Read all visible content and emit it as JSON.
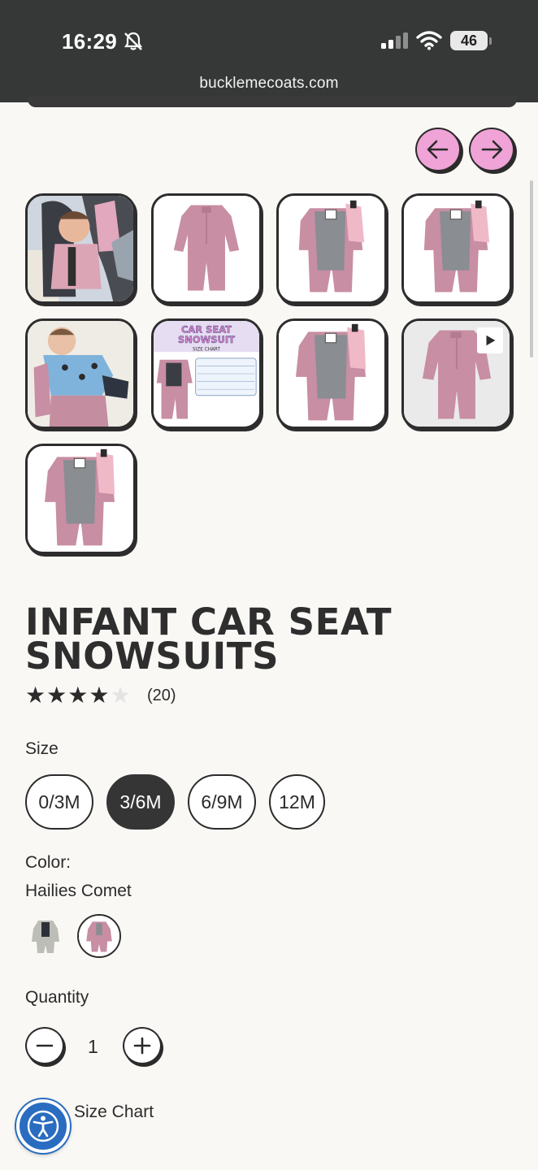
{
  "status_bar": {
    "time": "16:29",
    "battery": "46"
  },
  "browser": {
    "url": "bucklemecoats.com"
  },
  "gallery": {
    "prev_icon": "arrow-left-icon",
    "next_icon": "arrow-right-icon",
    "thumbnails": [
      {
        "kind": "baby-in-car-seat"
      },
      {
        "kind": "pink-snowsuit-front"
      },
      {
        "kind": "pink-snowsuit-open"
      },
      {
        "kind": "pink-snowsuit-open"
      },
      {
        "kind": "baby-wearing-suit"
      },
      {
        "kind": "size-chart-image",
        "chart_title": "CAR SEAT SNOWSUIT",
        "chart_subtitle": "SIZE CHART"
      },
      {
        "kind": "pink-snowsuit-open"
      },
      {
        "kind": "pink-snowsuit-video",
        "has_play": true
      },
      {
        "kind": "pink-snowsuit-open"
      }
    ]
  },
  "product": {
    "title": "INFANT CAR SEAT SNOWSUITS",
    "rating": 4,
    "rating_max": 5,
    "review_count": "(20)"
  },
  "size": {
    "label": "Size",
    "options": [
      "0/3M",
      "3/6M",
      "6/9M",
      "12M"
    ],
    "selected": "3/6M"
  },
  "color": {
    "label": "Color:",
    "selected_name": "Hailies Comet",
    "swatches": [
      "grey-snowsuit",
      "pink-snowsuit"
    ]
  },
  "quantity": {
    "label": "Quantity",
    "value": "1"
  },
  "size_chart": {
    "label": "Size Chart"
  },
  "colors": {
    "accent_pink": "#efa3d7",
    "dark": "#353535",
    "a11y_blue": "#2a6cc0"
  }
}
